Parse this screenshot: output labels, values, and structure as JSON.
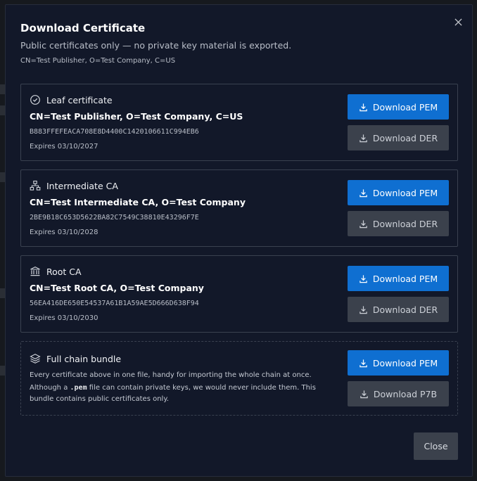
{
  "dialog": {
    "title": "Download Certificate",
    "subtitle": "Public certificates only — no private key material is exported.",
    "subject": "CN=Test Publisher, O=Test Company, C=US",
    "close_icon": "close-icon",
    "close_label": "Close"
  },
  "cards": [
    {
      "title": "Leaf certificate",
      "icon": "badge-check-icon",
      "cn": "CN=Test Publisher, O=Test Company, C=US",
      "fingerprint": "B883FFEFEACA708E8D4400C1420106611C994EB6",
      "expires": "Expires 03/10/2027",
      "primary_label": "Download PEM",
      "secondary_label": "Download DER"
    },
    {
      "title": "Intermediate CA",
      "icon": "hierarchy-icon",
      "cn": "CN=Test Intermediate CA, O=Test Company",
      "fingerprint": "2BE9B18C653D5622BA82C7549C38810E43296F7E",
      "expires": "Expires 03/10/2028",
      "primary_label": "Download PEM",
      "secondary_label": "Download DER"
    },
    {
      "title": "Root CA",
      "icon": "institution-icon",
      "cn": "CN=Test Root CA, O=Test Company",
      "fingerprint": "56EA416DE650E54537A61B1A59AE5D666D638F94",
      "expires": "Expires 03/10/2030",
      "primary_label": "Download PEM",
      "secondary_label": "Download DER"
    }
  ],
  "bundle": {
    "title": "Full chain bundle",
    "icon": "layers-icon",
    "description": "Every certificate above in one file, handy for importing the whole chain at once.",
    "note_pre": "Although a ",
    "note_code": ".pem",
    "note_post": " file can contain private keys, we would never include them. This bundle contains public certificates only.",
    "primary_label": "Download PEM",
    "secondary_label": "Download P7B"
  },
  "colors": {
    "primary": "#0f6fd1",
    "secondary": "#3b414c",
    "dialog_bg": "#121829"
  }
}
